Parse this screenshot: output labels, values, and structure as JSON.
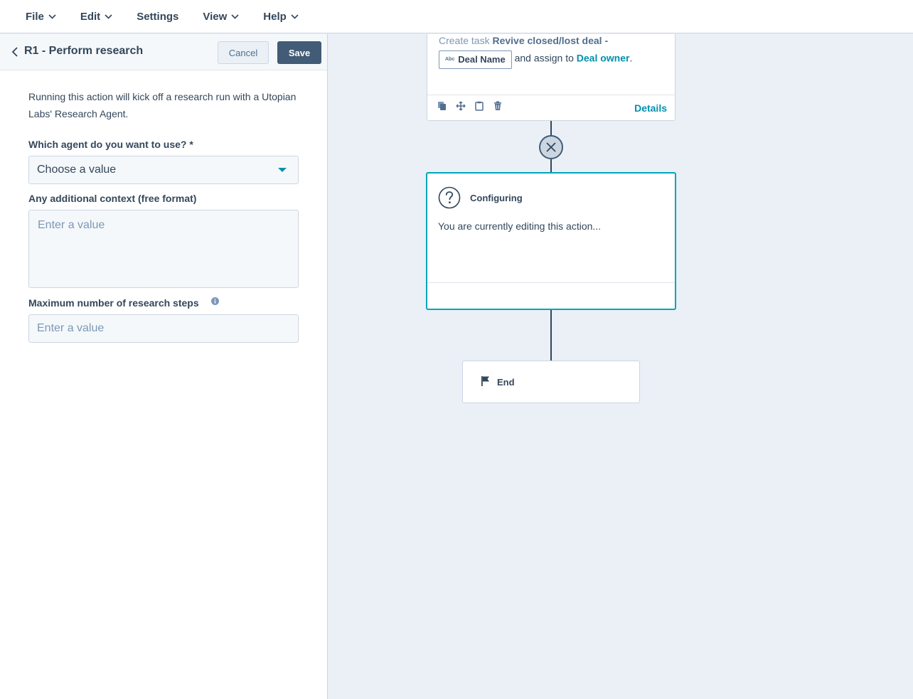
{
  "menu": {
    "items": [
      {
        "label": "File",
        "has_caret": true
      },
      {
        "label": "Edit",
        "has_caret": true
      },
      {
        "label": "Settings",
        "has_caret": false
      },
      {
        "label": "View",
        "has_caret": true
      },
      {
        "label": "Help",
        "has_caret": true
      }
    ]
  },
  "panel": {
    "title": "R1 - Perform research",
    "cancel_label": "Cancel",
    "save_label": "Save",
    "description": "Running this action will kick off a research run with a Utopian Labs' Research Agent.",
    "agent_field": {
      "label": "Which agent do you want to use? *",
      "value": "Choose a value"
    },
    "context_field": {
      "label": "Any additional context (free format)",
      "placeholder": "Enter a value"
    },
    "steps_field": {
      "label": "Maximum number of research steps",
      "placeholder": "Enter a value"
    }
  },
  "canvas": {
    "task_card": {
      "prefix": "Create task ",
      "task_name": "Revive closed/lost deal -",
      "token_type": "Abc",
      "token_label": "Deal Name",
      "assign_text": " and assign to ",
      "owner_link": "Deal owner",
      "suffix": ".",
      "details_label": "Details"
    },
    "config_card": {
      "title": "Configuring",
      "text": "You are currently editing this action..."
    },
    "end_card": {
      "label": "End"
    }
  },
  "colors": {
    "accent": "#0091ae",
    "primary_button": "#425b76",
    "canvas_bg": "#eaf0f6",
    "config_border": "#00a4bd"
  }
}
